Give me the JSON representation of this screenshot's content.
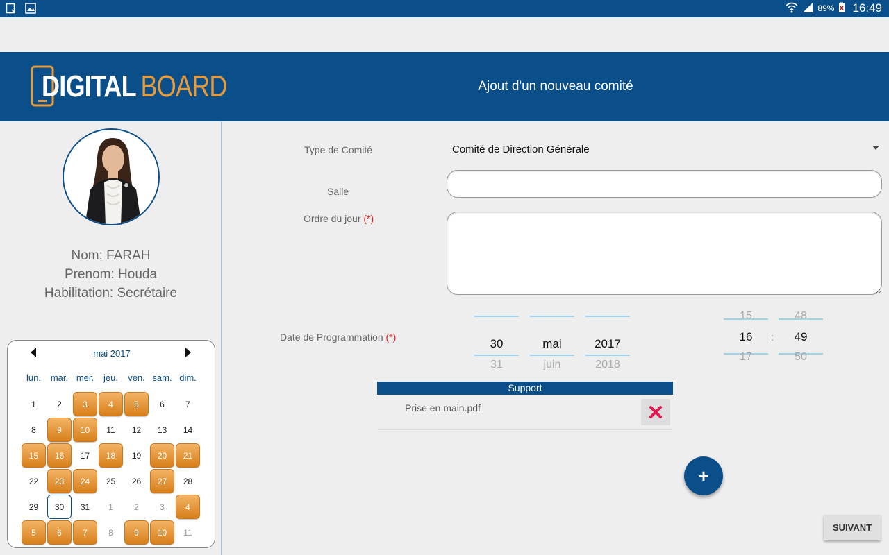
{
  "status_bar": {
    "battery": "89%",
    "time": "16:49",
    "icons": [
      "download-icon",
      "image-icon",
      "wifi-icon",
      "signal-icon",
      "battery-icon"
    ]
  },
  "header": {
    "logo_digital": "DIGITAL",
    "logo_board": "BOARD",
    "title": "Ajout d'un nouveau comité",
    "colors": {
      "primary": "#0b4f8a",
      "accent": "#e59a3c"
    }
  },
  "profile": {
    "nom": "Nom: FARAH",
    "prenom": "Prenom: Houda",
    "habilitation": "Habilitation: Secrétaire"
  },
  "calendar": {
    "month_label": "mai 2017",
    "weekdays": [
      "lun.",
      "mar.",
      "mer.",
      "jeu.",
      "ven.",
      "sam.",
      "dim."
    ],
    "days": [
      {
        "d": "1",
        "t": "n"
      },
      {
        "d": "2",
        "t": "n"
      },
      {
        "d": "3",
        "t": "e"
      },
      {
        "d": "4",
        "t": "e"
      },
      {
        "d": "5",
        "t": "e"
      },
      {
        "d": "6",
        "t": "n"
      },
      {
        "d": "7",
        "t": "n"
      },
      {
        "d": "8",
        "t": "n"
      },
      {
        "d": "9",
        "t": "e"
      },
      {
        "d": "10",
        "t": "e"
      },
      {
        "d": "11",
        "t": "n"
      },
      {
        "d": "12",
        "t": "n"
      },
      {
        "d": "13",
        "t": "n"
      },
      {
        "d": "14",
        "t": "n"
      },
      {
        "d": "15",
        "t": "e"
      },
      {
        "d": "16",
        "t": "e"
      },
      {
        "d": "17",
        "t": "n"
      },
      {
        "d": "18",
        "t": "e"
      },
      {
        "d": "19",
        "t": "n"
      },
      {
        "d": "20",
        "t": "e"
      },
      {
        "d": "21",
        "t": "e"
      },
      {
        "d": "22",
        "t": "n"
      },
      {
        "d": "23",
        "t": "e"
      },
      {
        "d": "24",
        "t": "e"
      },
      {
        "d": "25",
        "t": "n"
      },
      {
        "d": "26",
        "t": "n"
      },
      {
        "d": "27",
        "t": "e"
      },
      {
        "d": "28",
        "t": "n"
      },
      {
        "d": "29",
        "t": "n"
      },
      {
        "d": "30",
        "t": "today"
      },
      {
        "d": "31",
        "t": "n"
      },
      {
        "d": "1",
        "t": "o"
      },
      {
        "d": "2",
        "t": "o"
      },
      {
        "d": "3",
        "t": "o"
      },
      {
        "d": "4",
        "t": "oe"
      },
      {
        "d": "5",
        "t": "oe"
      },
      {
        "d": "6",
        "t": "oe"
      },
      {
        "d": "7",
        "t": "oe"
      },
      {
        "d": "8",
        "t": "o"
      },
      {
        "d": "9",
        "t": "oe"
      },
      {
        "d": "10",
        "t": "oe"
      },
      {
        "d": "11",
        "t": "o"
      }
    ]
  },
  "form": {
    "type_label": "Type de Comité",
    "type_value": "Comité de Direction Générale",
    "salle_label": "Salle",
    "salle_value": "",
    "ordre_label": "Ordre du jour",
    "ordre_value": "",
    "required_marker": "(*)",
    "date_label": "Date de Programmation",
    "date": {
      "day": {
        "prev": "",
        "cur": "30",
        "next": "31"
      },
      "month": {
        "prev": "",
        "cur": "mai",
        "next": "juin"
      },
      "year": {
        "prev": "",
        "cur": "2017",
        "next": "2018"
      }
    },
    "time": {
      "hour": {
        "prev": "15",
        "cur": "16",
        "next": "17"
      },
      "minute": {
        "prev": "48",
        "cur": "49",
        "next": "50"
      },
      "separator": ":"
    }
  },
  "support": {
    "header": "Support",
    "files": [
      "Prise en main.pdf"
    ]
  },
  "buttons": {
    "add": "+",
    "next": "SUIVANT"
  }
}
